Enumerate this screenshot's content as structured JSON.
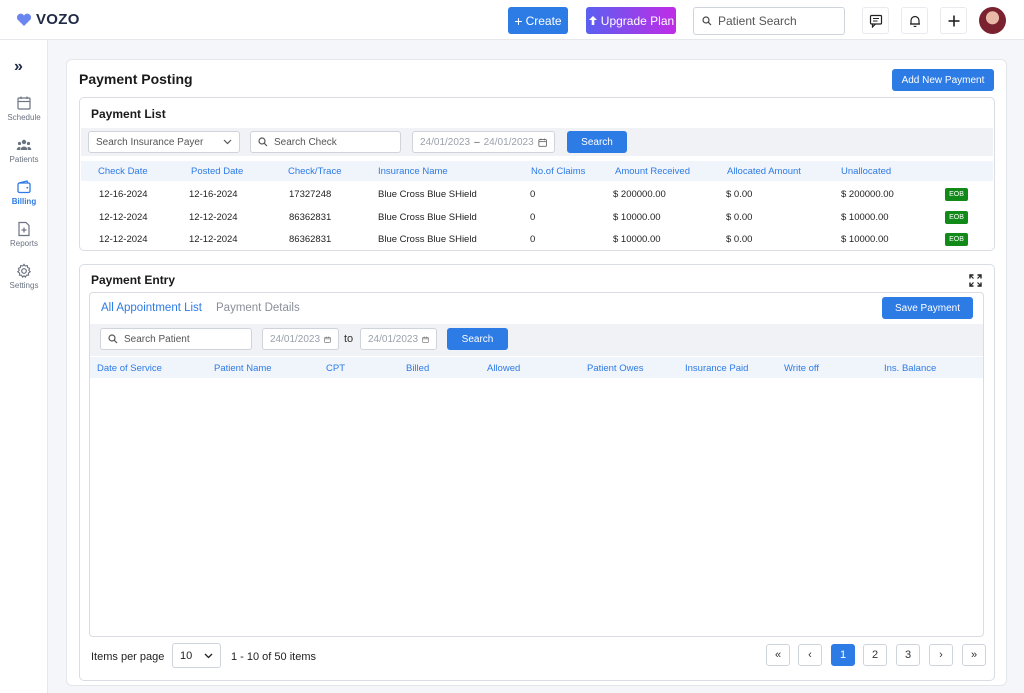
{
  "app": {
    "logo_text": "VOZO"
  },
  "topbar": {
    "create_label": "Create",
    "upgrade_label": "Upgrade Plan",
    "search_placeholder": "Patient Search"
  },
  "sidebar": {
    "items": [
      {
        "label": "Schedule",
        "icon": "calendar-icon"
      },
      {
        "label": "Patients",
        "icon": "patients-icon"
      },
      {
        "label": "Billing",
        "icon": "wallet-icon",
        "active": true
      },
      {
        "label": "Reports",
        "icon": "report-icon"
      },
      {
        "label": "Settings",
        "icon": "gear-icon"
      }
    ]
  },
  "page": {
    "title": "Payment Posting",
    "add_new_payment_label": "Add New Payment"
  },
  "payment_list": {
    "title": "Payment List",
    "insurance_payer_placeholder": "Search Insurance Payer",
    "check_placeholder": "Search Check",
    "date_from": "24/01/2023",
    "date_separator": "–",
    "date_to": "24/01/2023",
    "search_label": "Search",
    "columns": [
      "Check Date",
      "Posted Date",
      "Check/Trace",
      "Insurance Name",
      "No.of Claims",
      "Amount Received",
      "Allocated Amount",
      "Unallocated"
    ],
    "rows": [
      {
        "check_date": "12-16-2024",
        "posted_date": "12-16-2024",
        "check_trace": "17327248",
        "insurance_name": "Blue Cross Blue SHield",
        "claims": "0",
        "amount_received": "$ 200000.00",
        "allocated": "$ 0.00",
        "unallocated": "$ 200000.00",
        "action": "EOB"
      },
      {
        "check_date": "12-12-2024",
        "posted_date": "12-12-2024",
        "check_trace": "86362831",
        "insurance_name": "Blue Cross Blue SHield",
        "claims": "0",
        "amount_received": "$ 10000.00",
        "allocated": "$ 0.00",
        "unallocated": "$ 10000.00",
        "action": "EOB"
      },
      {
        "check_date": "12-12-2024",
        "posted_date": "12-12-2024",
        "check_trace": "86362831",
        "insurance_name": "Blue Cross Blue SHield",
        "claims": "0",
        "amount_received": "$ 10000.00",
        "allocated": "$ 0.00",
        "unallocated": "$ 10000.00",
        "action": "EOB"
      }
    ]
  },
  "payment_entry": {
    "title": "Payment Entry",
    "tabs": [
      "All Appointment List",
      "Payment Details"
    ],
    "save_label": "Save Payment",
    "patient_placeholder": "Search Patient",
    "date_from": "24/01/2023",
    "to_label": "to",
    "date_to": "24/01/2023",
    "search_label": "Search",
    "columns": [
      "Date of Service",
      "Patient Name",
      "CPT",
      "Billed",
      "Allowed",
      "Patient Owes",
      "Insurance Paid",
      "Write off",
      "Ins. Balance"
    ]
  },
  "pagination": {
    "items_per_page_label": "Items per page",
    "page_size": "10",
    "range_text": "1 - 10 of 50 items",
    "pages": [
      "1",
      "2",
      "3"
    ],
    "current_page": "1"
  },
  "colors": {
    "accent": "#2d7be5",
    "eob": "#128a1a"
  }
}
